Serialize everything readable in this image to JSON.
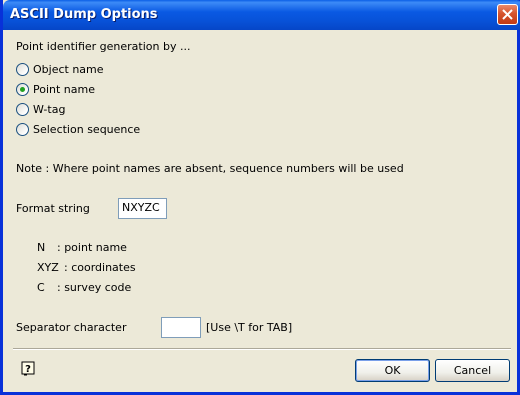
{
  "window": {
    "title": "ASCII Dump Options"
  },
  "group_label": "Point identifier generation by ...",
  "radios": [
    {
      "label": "Object name",
      "checked": false
    },
    {
      "label": "Point name",
      "checked": true
    },
    {
      "label": "W-tag",
      "checked": false
    },
    {
      "label": "Selection sequence",
      "checked": false
    }
  ],
  "note": "Note : Where point names are absent, sequence numbers will be used",
  "format": {
    "label": "Format string",
    "value": "NXYZC"
  },
  "legend": [
    {
      "key": "N",
      "desc": ": point name"
    },
    {
      "key": "XYZ",
      "desc": ": coordinates"
    },
    {
      "key": "C",
      "desc": ": survey code"
    }
  ],
  "separator": {
    "label": "Separator character",
    "value": "",
    "hint": "[Use \\T for TAB]"
  },
  "buttons": {
    "ok": "OK",
    "cancel": "Cancel"
  },
  "icons": {
    "close": "close-icon",
    "help": "help-icon"
  }
}
